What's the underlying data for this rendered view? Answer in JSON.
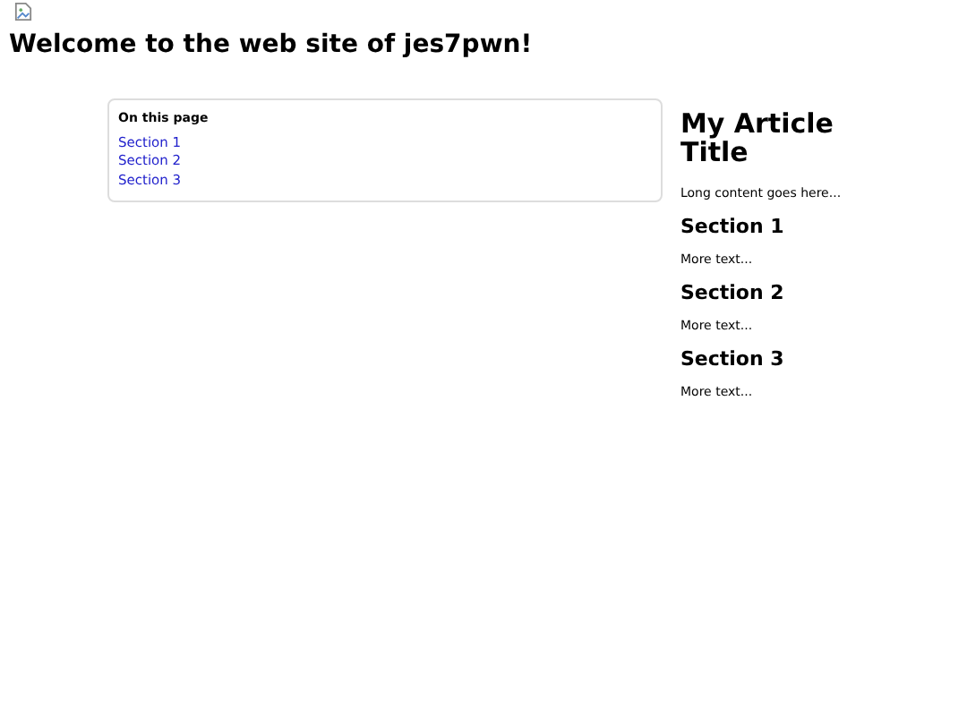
{
  "heading": "Welcome to the web site of jes7pwn!",
  "toc": {
    "title": "On this page",
    "links": [
      "Section 1",
      "Section 2",
      "Section 3"
    ]
  },
  "article": {
    "title": "My Article Title",
    "intro": "Long content goes here...",
    "sections": [
      {
        "heading": "Section 1",
        "text": "More text..."
      },
      {
        "heading": "Section 2",
        "text": "More text..."
      },
      {
        "heading": "Section 3",
        "text": "More text..."
      }
    ]
  }
}
